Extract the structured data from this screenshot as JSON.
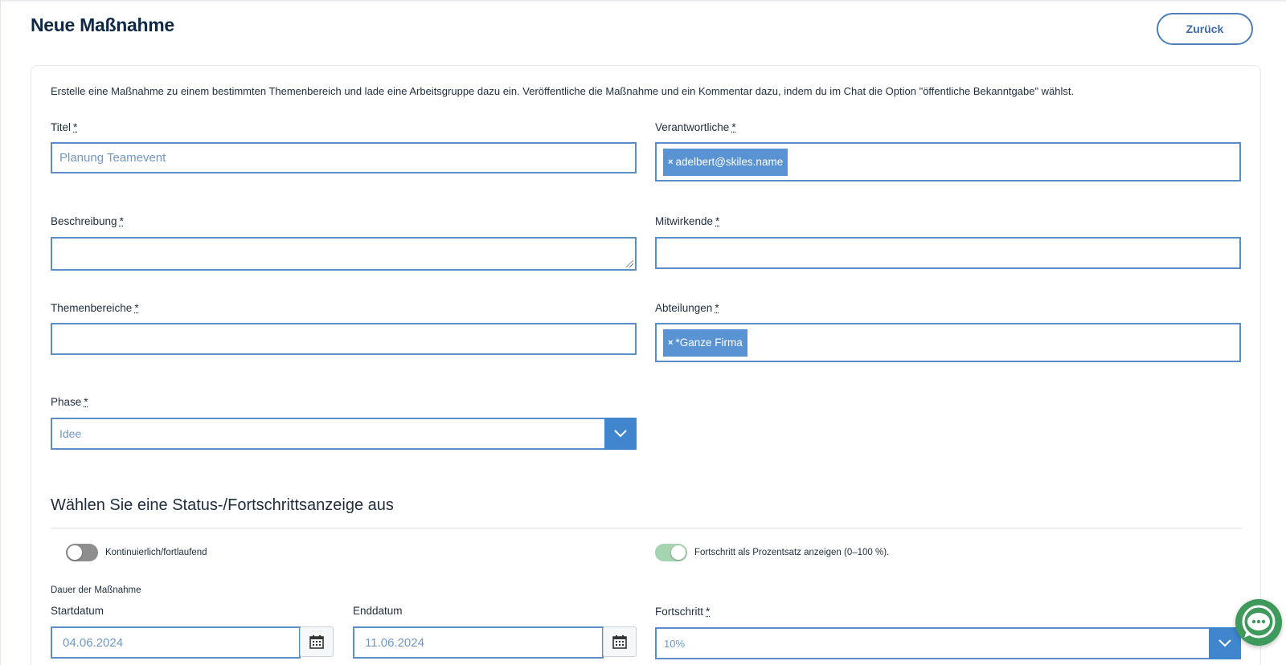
{
  "header": {
    "title": "Neue Maßnahme",
    "back_label": "Zurück"
  },
  "intro": "Erstelle eine Maßnahme zu einem bestimmten Themenbereich und lade eine Arbeitsgruppe dazu ein. Veröffentliche die Maßnahme und ein Kommentar dazu, indem du im Chat die Option \"öffentliche Bekanntgabe\" wählst.",
  "required_marker": "*",
  "form": {
    "title": {
      "label": "Titel",
      "value": "Planung Teamevent"
    },
    "responsible": {
      "label": "Verantwortliche",
      "tags": [
        "adelbert@skiles.name"
      ]
    },
    "description": {
      "label": "Beschreibung",
      "value": ""
    },
    "contributors": {
      "label": "Mitwirkende",
      "value": ""
    },
    "topics": {
      "label": "Themenbereiche",
      "value": ""
    },
    "departments": {
      "label": "Abteilungen",
      "tags": [
        "*Ganze Firma"
      ]
    },
    "phase": {
      "label": "Phase",
      "value": "Idee"
    }
  },
  "tag_remove_glyph": "×",
  "status_section": {
    "title": "Wählen Sie eine Status-/Fortschrittsanzeige aus",
    "toggle_continuous": {
      "label": "Kontinuierlich/fortlaufend",
      "on": false
    },
    "toggle_percent": {
      "label": "Fortschritt als Prozentsatz anzeigen (0–100 %).",
      "on": true
    },
    "duration_label": "Dauer der Maßnahme",
    "start": {
      "label": "Startdatum",
      "value": "04.06.2024"
    },
    "end": {
      "label": "Enddatum",
      "value": "11.06.2024"
    },
    "progress": {
      "label": "Fortschritt",
      "value": "10%"
    }
  },
  "colors": {
    "accent": "#3f86cf",
    "border": "#5b8ec7",
    "tag": "#5a93d3",
    "toggle_on": "#a6d3b0",
    "toggle_off": "#8e8e8e",
    "chat": "#3d9a5a"
  },
  "icons": {
    "calendar": "calendar-icon",
    "chevron": "chevron-down-icon",
    "chat": "chat-bubble-icon"
  }
}
